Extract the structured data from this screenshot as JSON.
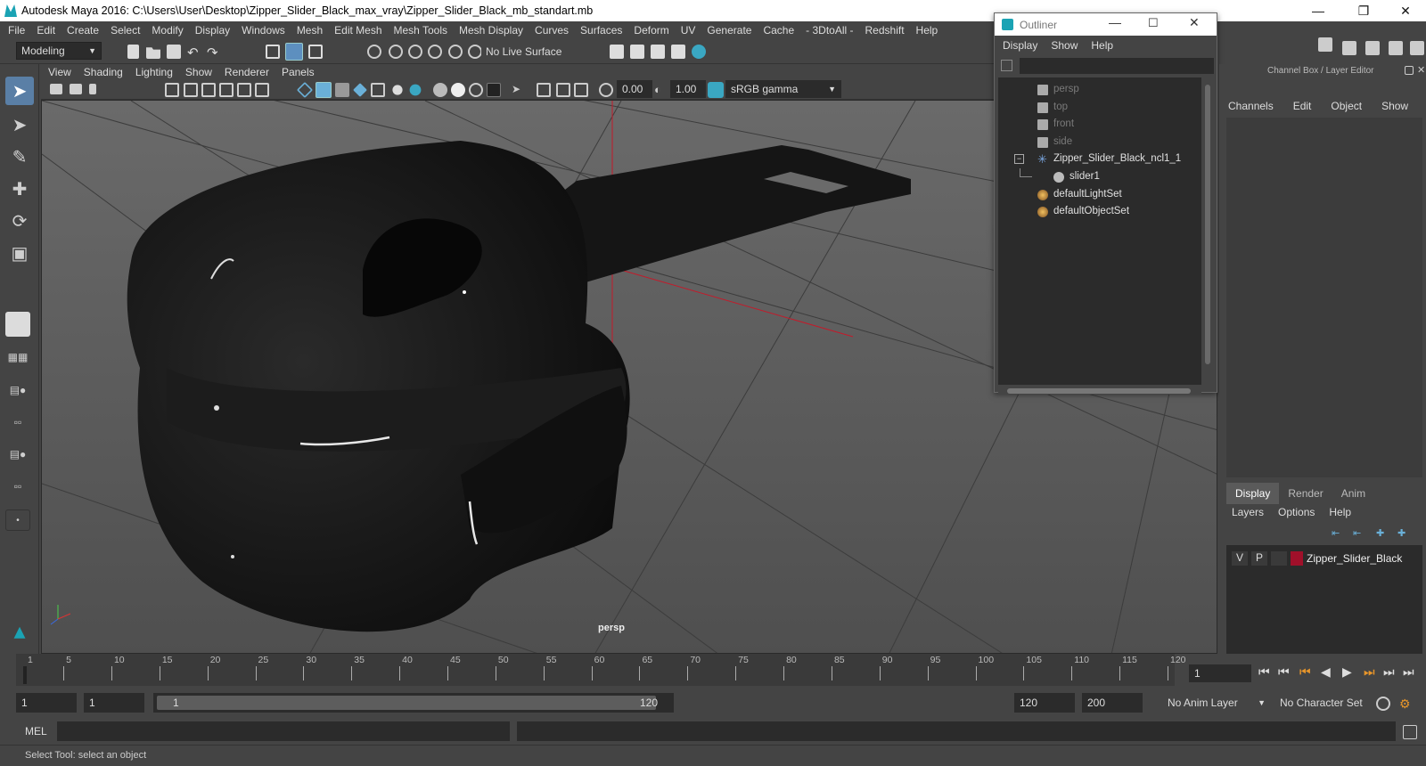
{
  "window": {
    "title": "Autodesk Maya 2016: C:\\Users\\User\\Desktop\\Zipper_Slider_Black_max_vray\\Zipper_Slider_Black_mb_standart.mb"
  },
  "menubar": {
    "items": [
      "File",
      "Edit",
      "Create",
      "Select",
      "Modify",
      "Display",
      "Windows",
      "Mesh",
      "Edit Mesh",
      "Mesh Tools",
      "Mesh Display",
      "Curves",
      "Surfaces",
      "Deform",
      "UV",
      "Generate",
      "Cache",
      "- 3DtoAll -",
      "Redshift",
      "Help"
    ]
  },
  "statusline": {
    "mode": "Modeling",
    "live_surface": "No Live Surface"
  },
  "panel": {
    "menu": [
      "View",
      "Shading",
      "Lighting",
      "Show",
      "Renderer",
      "Panels"
    ],
    "exposure": "0.00",
    "gamma": "1.00",
    "color_space": "sRGB gamma",
    "camera_label": "persp"
  },
  "outliner": {
    "title": "Outliner",
    "menu": [
      "Display",
      "Show",
      "Help"
    ],
    "items": [
      {
        "label": "persp",
        "type": "camera",
        "dim": true
      },
      {
        "label": "top",
        "type": "camera",
        "dim": true
      },
      {
        "label": "front",
        "type": "camera",
        "dim": true
      },
      {
        "label": "side",
        "type": "camera",
        "dim": true
      },
      {
        "label": "Zipper_Slider_Black_ncl1_1",
        "type": "group"
      },
      {
        "label": "slider1",
        "type": "mesh"
      },
      {
        "label": "defaultLightSet",
        "type": "set"
      },
      {
        "label": "defaultObjectSet",
        "type": "set"
      }
    ]
  },
  "channelbox": {
    "title": "Channel Box / Layer Editor",
    "menu": [
      "Channels",
      "Edit",
      "Object",
      "Show"
    ],
    "layer_tabs": [
      "Display",
      "Render",
      "Anim"
    ],
    "layer_menu": [
      "Layers",
      "Options",
      "Help"
    ],
    "layer": {
      "v": "V",
      "p": "P",
      "name": "Zipper_Slider_Black",
      "color": "#a0102a"
    }
  },
  "timeline": {
    "ticks": [
      "1",
      "5",
      "10",
      "15",
      "20",
      "25",
      "30",
      "35",
      "40",
      "45",
      "50",
      "55",
      "60",
      "65",
      "70",
      "75",
      "80",
      "85",
      "90",
      "95",
      "100",
      "105",
      "110",
      "115",
      "120"
    ],
    "current_frame": "1"
  },
  "range": {
    "start": "1",
    "playback_start": "1",
    "slider_start": "1",
    "slider_end": "120",
    "playback_end": "120",
    "end": "200",
    "anim_layer": "No Anim Layer",
    "character_set": "No Character Set"
  },
  "cmdline": {
    "label": "MEL"
  },
  "helpline": {
    "text": "Select Tool: select an object"
  }
}
